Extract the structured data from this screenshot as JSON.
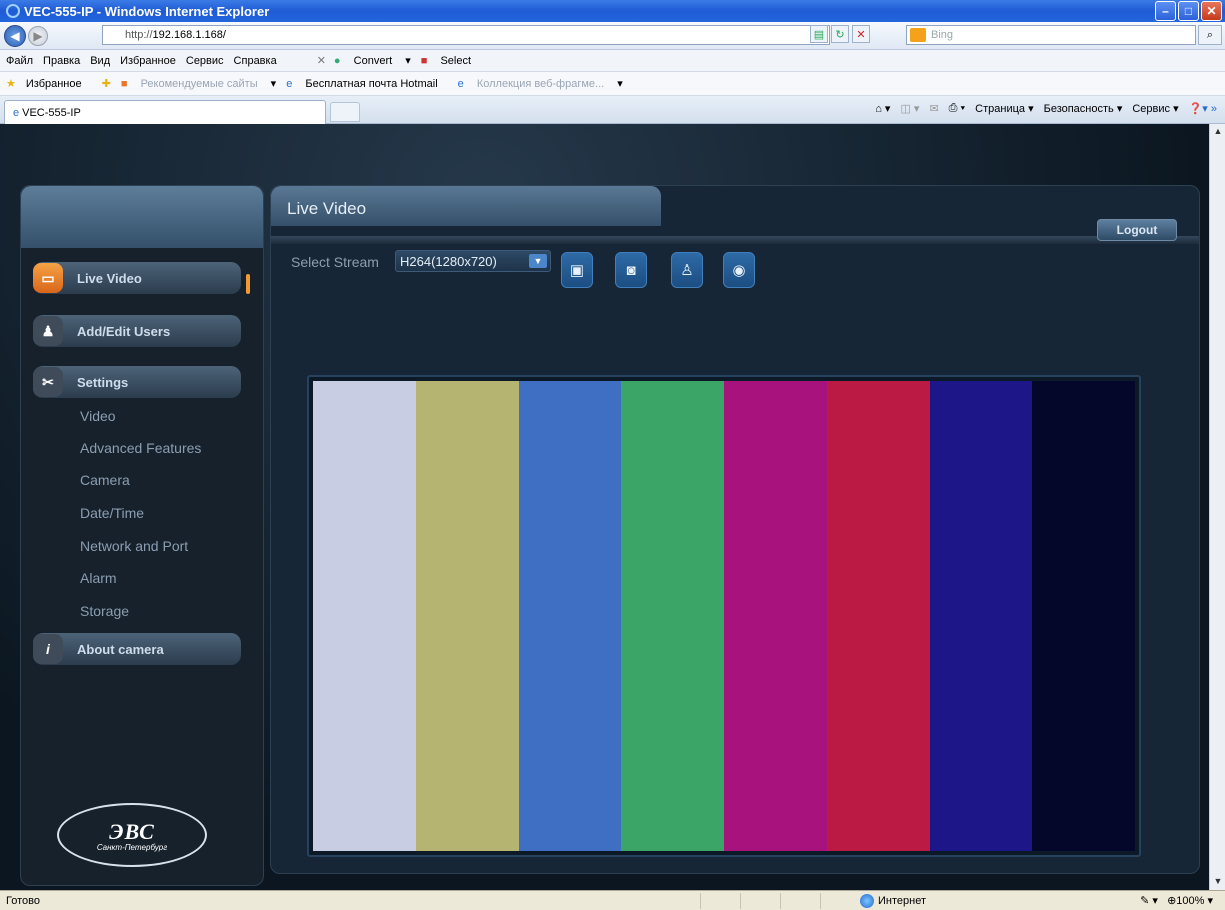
{
  "window": {
    "title": "VEC-555-IP - Windows Internet Explorer",
    "minimize": "–",
    "maximize": "□",
    "close": "✕"
  },
  "addressbar": {
    "url_prefix": "http://",
    "url_host": "192.168.1.168/",
    "search_placeholder": "Bing",
    "search_icon": "⌕"
  },
  "menubar": {
    "items": [
      "Файл",
      "Правка",
      "Вид",
      "Избранное",
      "Сервис",
      "Справка"
    ],
    "close_x": "✕",
    "convert": "Convert",
    "select": "Select"
  },
  "favbar": {
    "favorites": "Избранное",
    "recommended": "Рекомендуемые сайты",
    "hotmail": "Бесплатная почта Hotmail",
    "gallery": "Коллекция веб-фрагме..."
  },
  "tabs": {
    "active": "VEC-555-IP",
    "commands": [
      "Страница",
      "Безопасность",
      "Сервис"
    ]
  },
  "sidebar": {
    "nav": [
      {
        "label": "Live Video",
        "icon": "camera-icon"
      },
      {
        "label": "Add/Edit Users",
        "icon": "user-add-icon"
      },
      {
        "label": "Settings",
        "icon": "tools-icon"
      }
    ],
    "settings_items": [
      "Video",
      "Advanced Features",
      "Camera",
      "Date/Time",
      "Network and Port",
      "Alarm",
      "Storage"
    ],
    "about": {
      "label": "About camera",
      "icon": "info-icon"
    },
    "logo_main": "ЭВС",
    "logo_sub": "Санкт-Петербург"
  },
  "main": {
    "title": "Live Video",
    "logout": "Logout",
    "stream_label": "Select Stream",
    "stream_value": "H264(1280x720)",
    "tools": [
      "fullscreen-icon",
      "snapshot-icon",
      "alarm-bell-icon",
      "record-icon"
    ],
    "color_bars": [
      "#c9cde3",
      "#b5b471",
      "#3e6fc2",
      "#3aa567",
      "#a8127c",
      "#bb1a45",
      "#1c1689",
      "#05072a"
    ]
  },
  "statusbar": {
    "status": "Готово",
    "zone": "Интернет",
    "zoom": "100%"
  }
}
